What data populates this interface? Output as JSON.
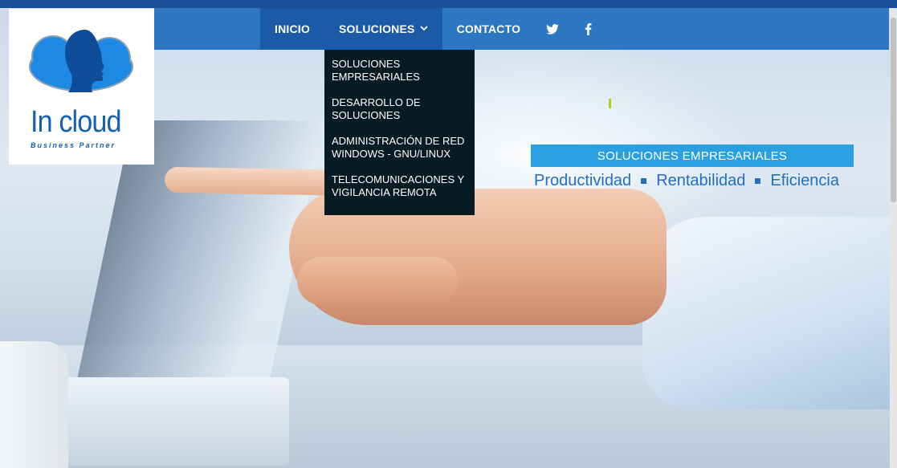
{
  "logo": {
    "name": "In cloud",
    "tagline": "Business Partner"
  },
  "nav": {
    "items": [
      {
        "label": "INICIO"
      },
      {
        "label": "SOLUCIONES"
      },
      {
        "label": "CONTACTO"
      }
    ],
    "social": {
      "twitter_icon": "twitter-icon",
      "facebook_icon": "facebook-icon"
    }
  },
  "dropdown": {
    "items": [
      {
        "label": "SOLUCIONES EMPRESARIALES"
      },
      {
        "label": "DESARROLLO DE SOLUCIONES"
      },
      {
        "label": "ADMINISTRACIÓN DE RED WINDOWS - GNU/LINUX"
      },
      {
        "label": "TELECOMUNICACIONES Y VIGILANCIA REMOTA"
      }
    ]
  },
  "hero": {
    "banner": "SOLUCIONES EMPRESARIALES",
    "taglines": [
      "Productividad",
      "Rentabilidad",
      "Eficiencia"
    ]
  },
  "colors": {
    "nav": "#2d77c2",
    "nav_active": "#1a5aa7",
    "dropdown": "#071b24",
    "banner": "#2aa0e1",
    "tagline": "#2170c4"
  }
}
